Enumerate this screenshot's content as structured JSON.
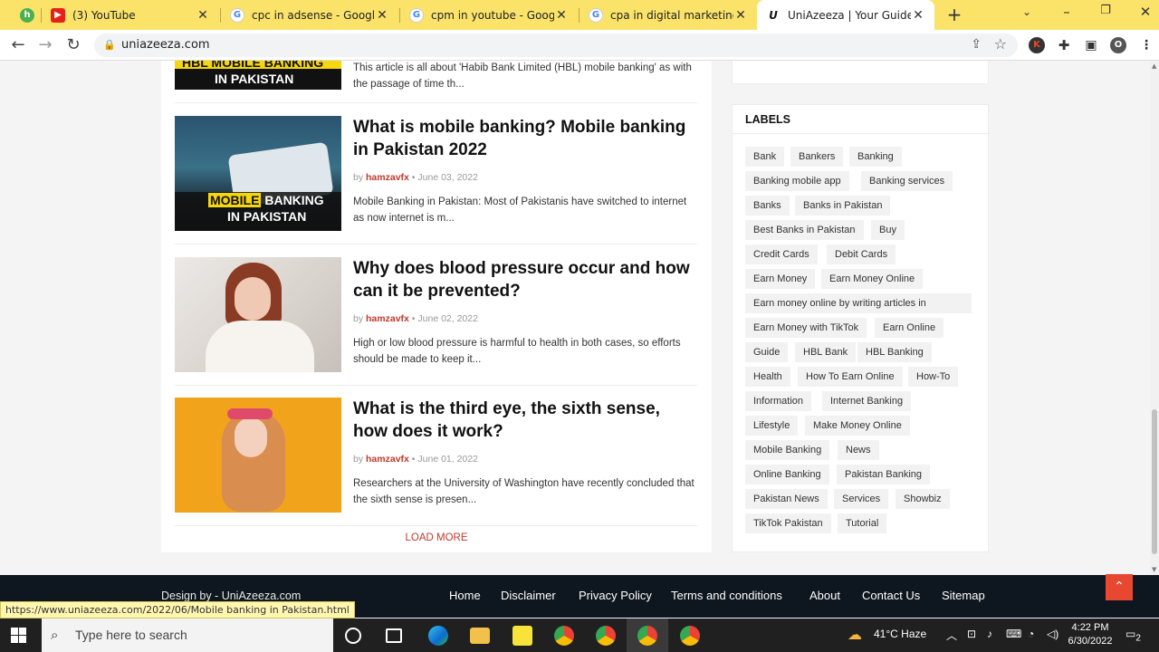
{
  "browser": {
    "tabs": [
      {
        "title": "",
        "favicon": "app-icon"
      },
      {
        "title": "(3) YouTube",
        "favicon": "youtube-icon"
      },
      {
        "title": "cpc in adsense - Google Se",
        "favicon": "google-icon"
      },
      {
        "title": "cpm in youtube - Google Se",
        "favicon": "google-icon"
      },
      {
        "title": "cpa in digital marketing - G",
        "favicon": "google-icon"
      },
      {
        "title": "UniAzeeza | Your Guide at H",
        "favicon": "uniazeeza-icon"
      }
    ],
    "url": "uniazeeza.com",
    "profile_initial": "O",
    "extension_initial": "K"
  },
  "posts_partial": {
    "thumb_line1_a": "HBL MOBILE",
    "thumb_line1_b": "BANKING",
    "thumb_line2": "IN PAKISTAN",
    "excerpt": "This article is all about 'Habib Bank Limited (HBL) mobile banking' as with the passage of time th..."
  },
  "posts": [
    {
      "title": "What is mobile banking? Mobile banking in Pakistan 2022",
      "author": "hamzavfx",
      "date": "June 03, 2022",
      "excerpt": "Mobile Banking in Pakistan:  Most of Pakistanis have  switched  to internet as now internet is m...",
      "thumb_line1_a": "MOBILE",
      "thumb_line1_b": "BANKING",
      "thumb_line2": "IN PAKISTAN"
    },
    {
      "title": "Why does blood pressure occur and how can it be prevented?",
      "author": "hamzavfx",
      "date": "June 02, 2022",
      "excerpt": "High or low blood pressure is harmful to health in both cases, so efforts should be made to keep it..."
    },
    {
      "title": "What is the third eye, the sixth sense, how does it work?",
      "author": "hamzavfx",
      "date": "June 01, 2022",
      "excerpt": "Researchers at the University of Washington have recently concluded that the sixth sense is presen..."
    }
  ],
  "by_label": "by",
  "load_more": "LOAD MORE",
  "labels": {
    "heading": "LABELS",
    "items": [
      "Bank",
      "Bankers",
      "Banking",
      "Banking mobile app",
      "Banking services",
      "Banks",
      "Banks in Pakistan",
      "Best Banks in Pakistan",
      "Buy",
      "Credit Cards",
      "Debit Cards",
      "Earn Money",
      "Earn Money Online",
      "Earn money online by writing articles in Pakistan",
      "Earn Money with TikTok",
      "Earn Online",
      "Guide",
      "HBL Bank",
      "HBL Banking",
      "Health",
      "How To Earn Online",
      "How-To",
      "Information",
      "Internet Banking",
      "Lifestyle",
      "Make Money Online",
      "Mobile Banking",
      "News",
      "Online Banking",
      "Pakistan Banking",
      "Pakistan News",
      "Services",
      "Showbiz",
      "TikTok Pakistan",
      "Tutorial"
    ]
  },
  "footer": {
    "design": "Design by - UniAzeeza.com",
    "links": [
      "Home",
      "Disclaimer",
      "Privacy Policy",
      "Terms and conditions",
      "About",
      "Contact Us",
      "Sitemap"
    ]
  },
  "status_url": "https://www.uniazeeza.com/2022/06/Mobile banking in Pakistan.html",
  "taskbar": {
    "search_placeholder": "Type here to search",
    "weather": "41°C  Haze",
    "time": "4:22 PM",
    "date": "6/30/2022",
    "notifications": "2"
  },
  "colors": {
    "accent": "#c0392b",
    "tab_bar": "#fbe36a",
    "footer": "#0e1620",
    "to_top": "#e84730"
  }
}
